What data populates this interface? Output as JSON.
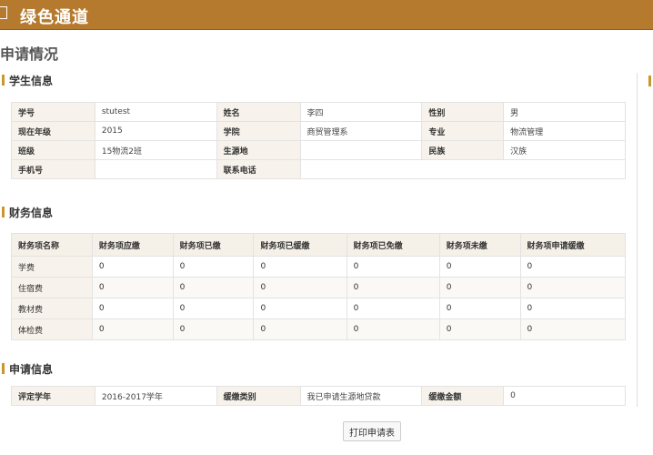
{
  "header": {
    "title": "绿色通道"
  },
  "page_title": "申请情况",
  "student_section": {
    "title": "学生信息",
    "rows": [
      [
        {
          "label": "学号",
          "value": "stutest"
        },
        {
          "label": "姓名",
          "value": "李四"
        },
        {
          "label": "性别",
          "value": "男"
        }
      ],
      [
        {
          "label": "现在年级",
          "value": "2015"
        },
        {
          "label": "学院",
          "value": "商贸管理系"
        },
        {
          "label": "专业",
          "value": "物流管理"
        }
      ],
      [
        {
          "label": "班级",
          "value": "15物流2班"
        },
        {
          "label": "生源地",
          "value": ""
        },
        {
          "label": "民族",
          "value": "汉族"
        }
      ],
      [
        {
          "label": "手机号",
          "value": ""
        },
        {
          "label": "联系电话",
          "value": ""
        }
      ]
    ]
  },
  "finance_section": {
    "title": "财务信息",
    "headers": [
      "财务项名称",
      "财务项应缴",
      "财务项已缴",
      "财务项已缓缴",
      "财务项已免缴",
      "财务项未缴",
      "财务项申请缓缴"
    ],
    "rows": [
      [
        "学费",
        "0",
        "0",
        "0",
        "0",
        "0",
        "0"
      ],
      [
        "住宿费",
        "0",
        "0",
        "0",
        "0",
        "0",
        "0"
      ],
      [
        "教材费",
        "0",
        "0",
        "0",
        "0",
        "0",
        "0"
      ],
      [
        "体检费",
        "0",
        "0",
        "0",
        "0",
        "0",
        "0"
      ]
    ]
  },
  "apply_section": {
    "title": "申请信息",
    "row": [
      {
        "label": "评定学年",
        "value": "2016-2017学年"
      },
      {
        "label": "缓缴类别",
        "value": "我已申请生源地贷款"
      },
      {
        "label": "缓缴金额",
        "value": "0"
      }
    ]
  },
  "footer": {
    "print_label": "打印申请表"
  }
}
